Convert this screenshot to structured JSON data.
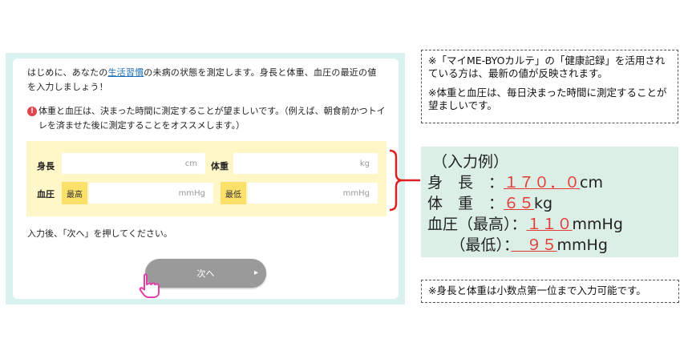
{
  "form": {
    "intro_before": "はじめに、あなたの",
    "intro_link": "生活習慣",
    "intro_after": "の未病の状態を測定します。身長と体重、血圧の最近の値を入力しましょう！",
    "notice_icon": "!",
    "notice": "体重と血圧は、決まった時間に測定することが望ましいです。（例えば、朝食前かつトイレを済ませた後に測定することをオススメします。）",
    "height_label": "身長",
    "height_unit": "cm",
    "weight_label": "体重",
    "weight_unit": "kg",
    "bp_label": "血圧",
    "bp_high_label": "最高",
    "bp_high_unit": "mmHg",
    "bp_low_label": "最低",
    "bp_low_unit": "mmHg",
    "after_input": "入力後、「次へ」を押してください。",
    "next_button": "次へ",
    "next_arrow": "▸"
  },
  "notes": {
    "note1_p1": "※「マイME-BYOカルテ」の「健康記録」を活用されている方は、最新の値が反映されます。",
    "note1_p2": "※体重と血圧は、毎日決まった時間に測定することが望ましいです。",
    "note2": "※身長と体重は小数点第一位まで入力可能です。"
  },
  "example": {
    "title": "（入力例）",
    "height_label": "身　長　：",
    "height_value": "１７０．０",
    "height_unit": "cm",
    "weight_label": "体　重　：",
    "weight_value": "６５",
    "weight_unit": "kg",
    "bp_high_label": "血圧（最高）：",
    "bp_high_value": "１１０",
    "bp_high_unit": "mmHg",
    "bp_low_label": "　　（最低）：",
    "bp_low_value": "　９５",
    "bp_low_unit": "mmHg"
  },
  "colors": {
    "panel_bg": "#d9f1ef",
    "form_bg": "#fff7c8",
    "label_bg": "#fbe06a",
    "button": "#9a9a9a",
    "accent_red": "#e53935",
    "hand": "#e23fa7",
    "example_bg": "#dcefe6"
  },
  "icons": [
    "exclamation-icon",
    "chevron-right-icon",
    "pointing-hand-icon",
    "bracket-connector"
  ]
}
